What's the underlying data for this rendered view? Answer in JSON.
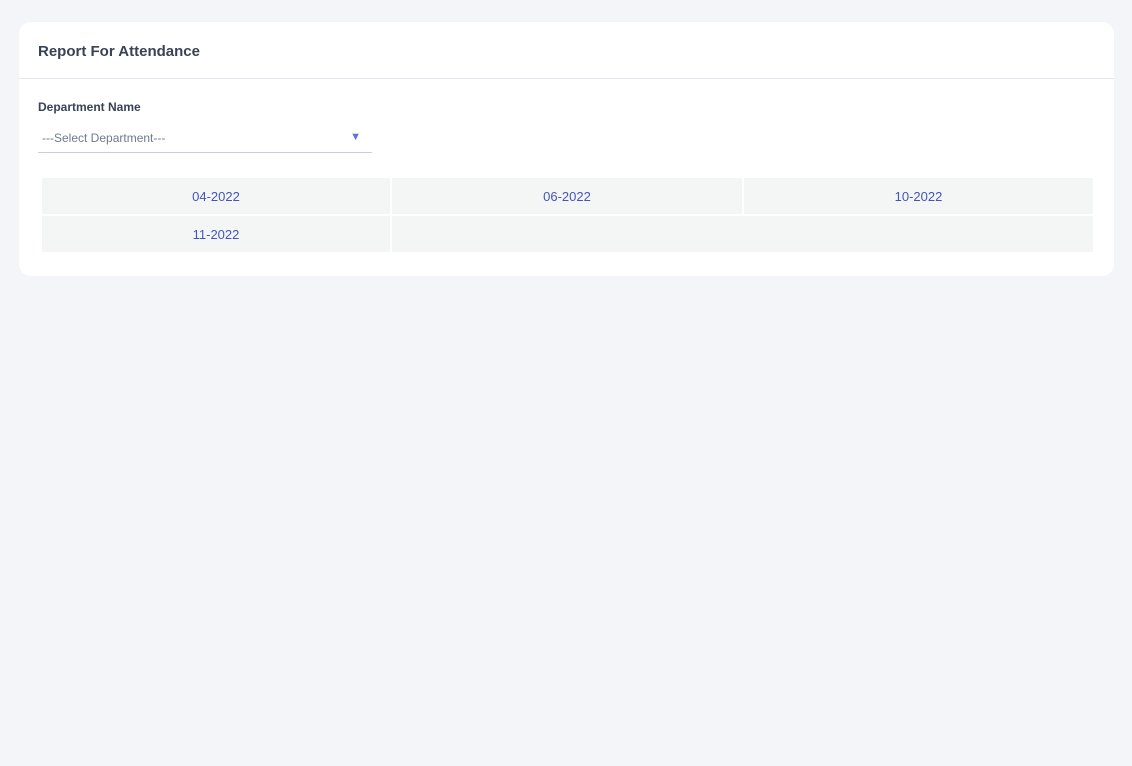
{
  "report": {
    "title": "Report For Attendance"
  },
  "filter": {
    "department_label": "Department Name",
    "department_select": {
      "selected": "---Select Department---",
      "caret_icon": "caret-down-icon"
    }
  },
  "months": [
    "04-2022",
    "06-2022",
    "10-2022",
    "11-2022"
  ],
  "colors": {
    "page_background": "#f3f5f9",
    "card_background": "#ffffff",
    "link_text": "#4554b8",
    "cell_background": "#f4f6f6",
    "caret": "#5b74d6"
  }
}
